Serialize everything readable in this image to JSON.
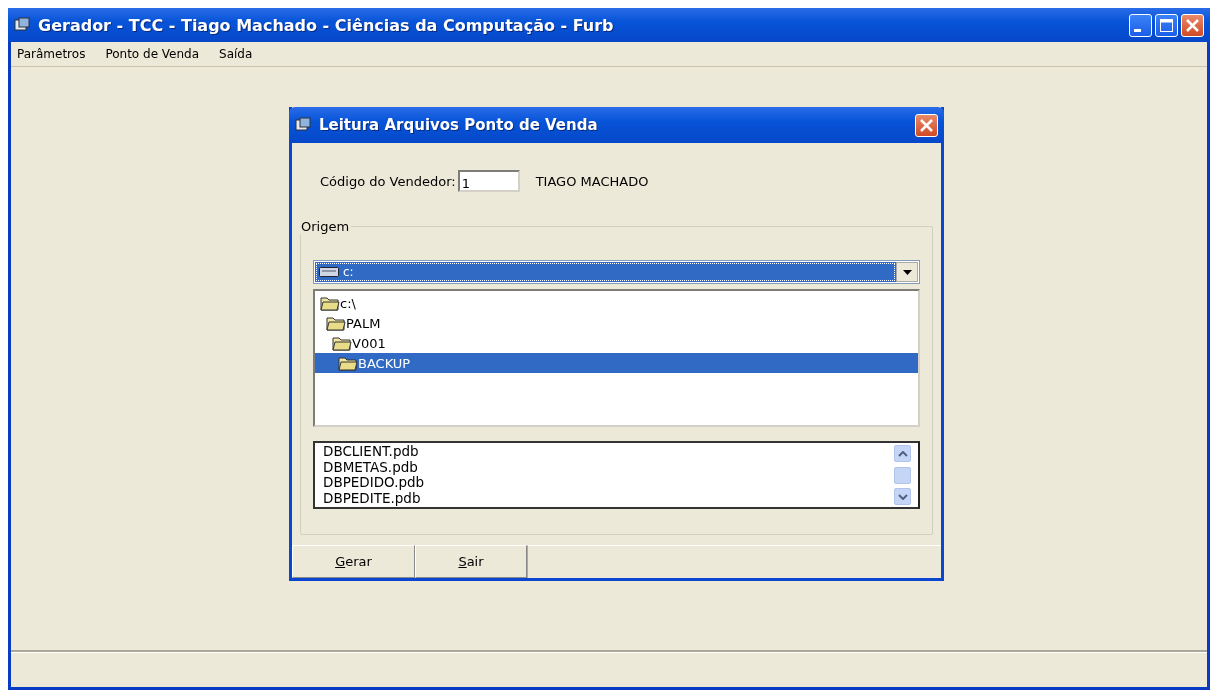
{
  "window": {
    "title": "Gerador - TCC - Tiago Machado - Ciências da Computação - Furb"
  },
  "menu": [
    "Parâmetros",
    "Ponto de Venda",
    "Saída"
  ],
  "dialog": {
    "title": "Leitura Arquivos Ponto de Venda",
    "vendor": {
      "label": "Código do Vendedor:",
      "value": "1",
      "name": "TIAGO MACHADO"
    },
    "origin": {
      "legend": "Origem",
      "drive": "c:",
      "tree": [
        {
          "label": "c:\\",
          "selected": false,
          "children": [
            {
              "label": "PALM",
              "selected": false,
              "children": [
                {
                  "label": "V001",
                  "selected": false,
                  "children": [
                    {
                      "label": "BACKUP",
                      "selected": true
                    }
                  ]
                }
              ]
            }
          ]
        }
      ],
      "files": [
        "DBCLIENT.pdb",
        "DBMETAS.pdb",
        "DBPEDIDO.pdb",
        "DBPEDITE.pdb"
      ]
    },
    "buttons": [
      "Gerar",
      "Sair"
    ]
  }
}
